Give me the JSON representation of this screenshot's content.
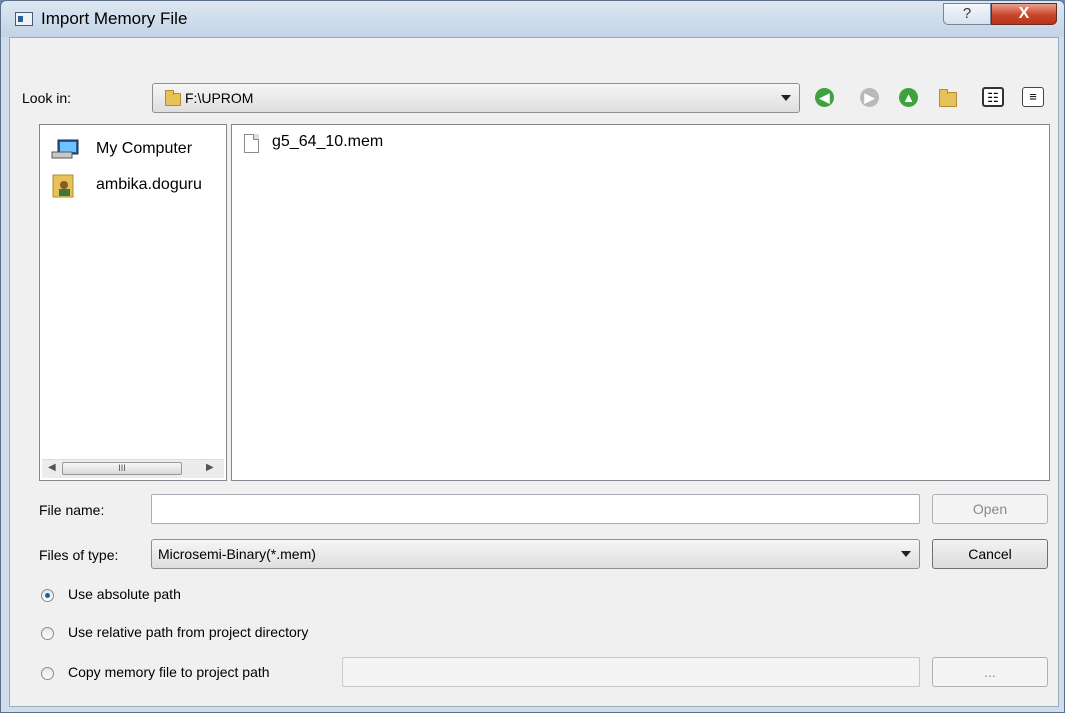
{
  "window": {
    "title": "Import Memory File",
    "help_label": "?",
    "close_label": "X"
  },
  "lookin": {
    "label": "Look in:",
    "path": "F:\\UPROM"
  },
  "toolbar": {
    "back_glyph": "◀",
    "forward_glyph": "▶",
    "up_glyph": "▲",
    "new_folder_glyph": "✱",
    "list_view_glyph": "☷",
    "detail_view_glyph": "≡"
  },
  "sidebar": {
    "items": [
      {
        "label": "My Computer",
        "icon": "computer-icon"
      },
      {
        "label": "ambika.doguru",
        "icon": "user-folder-icon"
      }
    ],
    "scroll_thumb": "III"
  },
  "files": [
    {
      "name": "g5_64_10.mem",
      "icon": "file-icon"
    }
  ],
  "filename": {
    "label": "File name:",
    "value": "",
    "open_label": "Open"
  },
  "filetype": {
    "label": "Files of type:",
    "value": "Microsemi-Binary(*.mem)",
    "cancel_label": "Cancel"
  },
  "options": {
    "absolute": "Use absolute path",
    "relative": "Use relative path from project directory",
    "copy": "Copy memory file to project path",
    "browse_label": "..."
  }
}
